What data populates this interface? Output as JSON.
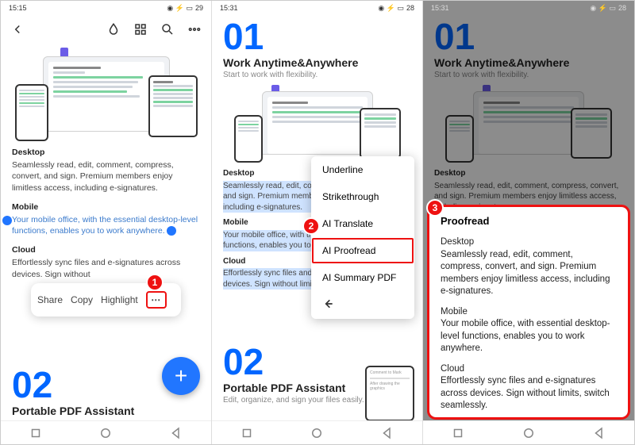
{
  "status": {
    "time1": "15:15",
    "time2": "15:31",
    "time3": "15:31",
    "battery": "29",
    "battery2": "28",
    "battery3": "28"
  },
  "screen1": {
    "num": "02",
    "heading": "Portable PDF Assistant",
    "sections": {
      "desktop": {
        "title": "Desktop",
        "text": "Seamlessly read, edit, comment, compress, convert, and sign. Premium members enjoy limitless access, including e-signatures."
      },
      "mobile": {
        "title": "Mobile",
        "text": "Your mobile office, with the essential desktop-level functions, enables you to work anywhere."
      },
      "cloud": {
        "title": "Cloud",
        "text": "Effortlessly sync files and e-signatures across devices. Sign without"
      }
    },
    "ctx": {
      "share": "Share",
      "copy": "Copy",
      "highlight": "Highlight",
      "more": "⋯"
    },
    "badge": "1"
  },
  "screen2": {
    "num1": "01",
    "heading1": "Work Anytime&Anywhere",
    "sub1": "Start to work with flexibility.",
    "num2": "02",
    "heading2": "Portable PDF Assistant",
    "sub2": "Edit, organize, and sign your files easily.",
    "sections": {
      "desktop": {
        "title": "Desktop",
        "text": "Seamlessly read, edit, comment, compress, convert, and sign. Premium members enjoy limitless access, including e-signatures."
      },
      "mobile": {
        "title": "Mobile",
        "text": "Your mobile office, with the essential desktop-level functions, enables you to work anywhere."
      },
      "cloud": {
        "title": "Cloud",
        "text": "Effortlessly sync files and e-signatures across devices. Sign without limits, switch seamless"
      }
    },
    "menu": {
      "underline": "Underline",
      "strike": "Strikethrough",
      "translate": "AI Translate",
      "proofread": "AI Proofread",
      "summary": "AI Summary PDF"
    },
    "badge": "2"
  },
  "screen3": {
    "num1": "01",
    "heading1": "Work Anytime&Anywhere",
    "sub1": "Start to work with flexibility.",
    "sections": {
      "desktop": {
        "title": "Desktop",
        "text": "Seamlessly read, edit, comment, compress, convert, and sign. Premium members enjoy limitless access, including e-signatures."
      }
    },
    "pf": {
      "title": "Proofread",
      "desktop": {
        "title": "Desktop",
        "text": "Seamlessly read, edit, comment, compress, convert, and sign. Premium members enjoy limitless access, including e-signatures."
      },
      "mobile": {
        "title": "Mobile",
        "text": "Your mobile office, with essential desktop-level functions, enables you to work anywhere."
      },
      "cloud": {
        "title": "Cloud",
        "text": "Effortlessly sync files and e-signatures across devices. Sign without limits, switch seamlessly."
      }
    },
    "badge": "3"
  }
}
